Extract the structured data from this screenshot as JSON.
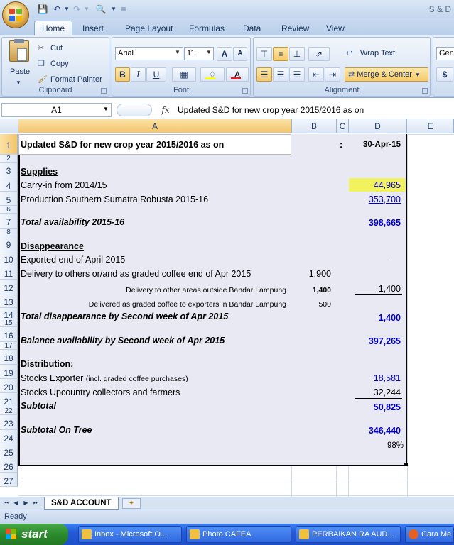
{
  "window": {
    "title": "S & D"
  },
  "ribbon": {
    "tabs": [
      "Home",
      "Insert",
      "Page Layout",
      "Formulas",
      "Data",
      "Review",
      "View"
    ],
    "clipboard": {
      "paste": "Paste",
      "cut": "Cut",
      "copy": "Copy",
      "format_painter": "Format Painter",
      "label": "Clipboard"
    },
    "font": {
      "name": "Arial",
      "size": "11",
      "label": "Font",
      "bold": "B",
      "italic": "I",
      "underline": "U",
      "grow": "A",
      "shrink": "A",
      "font_color": "A"
    },
    "alignment": {
      "wrap_text": "Wrap Text",
      "merge_center": "Merge & Center",
      "label": "Alignment"
    },
    "number": {
      "format": "Gen",
      "currency": "$"
    }
  },
  "formula_bar": {
    "name_box": "A1",
    "fx": "fx",
    "content": "Updated S&D for new crop year 2015/2016 as on"
  },
  "columns": [
    "A",
    "B",
    "C",
    "D",
    "E"
  ],
  "rows": [
    "1",
    "2",
    "3",
    "4",
    "5",
    "6",
    "7",
    "8",
    "9",
    "10",
    "11",
    "12",
    "13",
    "14",
    "15",
    "16",
    "17",
    "18",
    "19",
    "20",
    "21",
    "22",
    "23",
    "24",
    "25",
    "26",
    "27"
  ],
  "cells": {
    "r1_a": "Updated S&D for new crop year 2015/2016 as on",
    "r1_c": ":",
    "r1_d": "30-Apr-15",
    "r3_a": "Supplies",
    "r4_a": "Carry-in from 2014/15",
    "r4_d": "44,965",
    "r5_a": "Production Southern Sumatra Robusta 2015-16",
    "r5_d": "353,700",
    "r7_a": "Total availability 2015-16",
    "r7_d": "398,665",
    "r9_a": "Disappearance",
    "r10_a": "Exported  end of April 2015",
    "r10_d": "-",
    "r11_a": "Delivery to others or/and as graded coffee end of Apr 2015",
    "r11_b": "1,900",
    "r12_a": "Delivery to other areas outside Bandar Lampung",
    "r12_b": "1,400",
    "r12_d": "1,400",
    "r13_a": "Delivered as graded coffee to exporters in Bandar Lampung",
    "r13_b": "500",
    "r14_a": "Total disappearance by Second week of Apr 2015",
    "r14_d": "1,400",
    "r16_a": "Balance availability by Second week of Apr 2015",
    "r16_d": "397,265",
    "r18_a": "Distribution:",
    "r19_a": "Stocks Exporter",
    "r19_a_note": "(incl. graded coffee purchases)",
    "r19_d": "18,581",
    "r20_a": "Stocks Upcountry collectors and farmers",
    "r20_d": "32,244",
    "r21_a": "Subtotal",
    "r21_d": "50,825",
    "r23_a": "Subtotal  On Tree",
    "r23_d": "346,440",
    "r24_d": "98%"
  },
  "sheet_tabs": {
    "active": "S&D ACCOUNT"
  },
  "status": {
    "text": "Ready"
  },
  "taskbar": {
    "start": "start",
    "items": [
      "Inbox - Microsoft O...",
      "Photo CAFEA",
      "PERBAIKAN RA AUD...",
      "Cara Me"
    ]
  },
  "colors": {
    "highlight": "#f2f25e",
    "blue_text": "#0000cc",
    "shade": "#e9e9f3"
  }
}
